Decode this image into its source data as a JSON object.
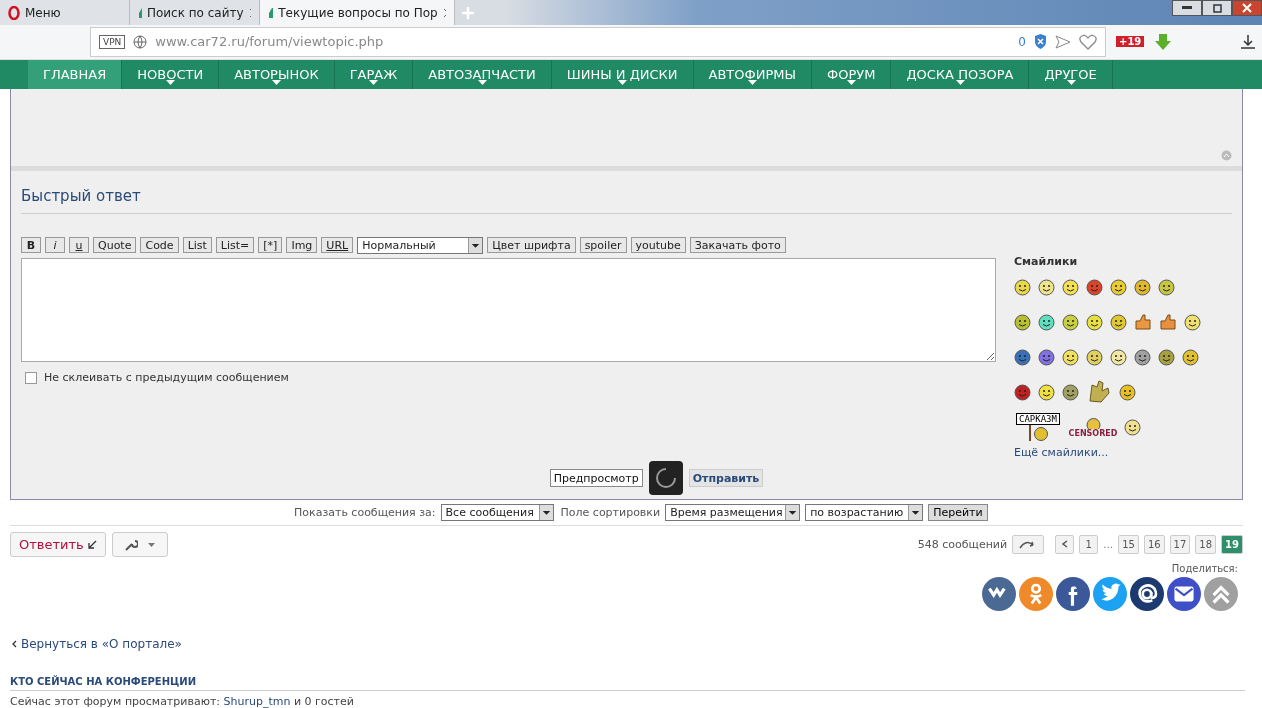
{
  "browser": {
    "tabs": [
      {
        "title": "Меню",
        "selected": false,
        "kind": "menu"
      },
      {
        "title": "Поиск по сайту",
        "selected": false,
        "kind": "page"
      },
      {
        "title": "Текущие вопросы по Пор",
        "selected": true,
        "kind": "page"
      }
    ],
    "vpn": "VPN",
    "url": "www.car72.ru/forum/viewtopic.php",
    "blocked_count": "0",
    "badge": "+19"
  },
  "nav": [
    {
      "label": "ГЛАВНАЯ",
      "selected": true,
      "has_menu": false
    },
    {
      "label": "НОВОСТИ",
      "selected": false,
      "has_menu": true
    },
    {
      "label": "АВТОРЫНОК",
      "selected": false,
      "has_menu": true
    },
    {
      "label": "ГАРАЖ",
      "selected": false,
      "has_menu": true
    },
    {
      "label": "АВТОЗАПЧАСТИ",
      "selected": false,
      "has_menu": true
    },
    {
      "label": "ШИНЫ И ДИСКИ",
      "selected": false,
      "has_menu": true
    },
    {
      "label": "АВТОФИРМЫ",
      "selected": false,
      "has_menu": true
    },
    {
      "label": "ФОРУМ",
      "selected": false,
      "has_menu": true
    },
    {
      "label": "ДОСКА ПОЗОРА",
      "selected": false,
      "has_menu": true
    },
    {
      "label": "ДРУГОЕ",
      "selected": false,
      "has_menu": true
    }
  ],
  "quick_reply": {
    "title": "Быстрый ответ",
    "toolbar": [
      {
        "label": "B",
        "kind": "bold"
      },
      {
        "label": "i",
        "kind": "italic"
      },
      {
        "label": "u",
        "kind": "underline"
      },
      {
        "label": "Quote",
        "kind": "plain"
      },
      {
        "label": "Code",
        "kind": "plain"
      },
      {
        "label": "List",
        "kind": "plain"
      },
      {
        "label": "List=",
        "kind": "plain"
      },
      {
        "label": "[*]",
        "kind": "plain"
      },
      {
        "label": "Img",
        "kind": "plain"
      },
      {
        "label": "URL",
        "kind": "link"
      },
      {
        "label": "Нормальный",
        "kind": "select"
      },
      {
        "label": "Цвет шрифта",
        "kind": "plain"
      },
      {
        "label": "spoiler",
        "kind": "plain"
      },
      {
        "label": "youtube",
        "kind": "plain"
      },
      {
        "label": "Закачать фото",
        "kind": "plain"
      }
    ],
    "no_merge": {
      "label": "Не склеивать с предыдущим сообщением",
      "checked": false
    },
    "smilies_title": "Смайлики",
    "smilies": [
      [
        {
          "kind": "face",
          "color": "#e8d84a"
        },
        {
          "kind": "face",
          "color": "#eee48a"
        },
        {
          "kind": "face",
          "color": "#f2e050"
        },
        {
          "kind": "face",
          "color": "#d9442a"
        },
        {
          "kind": "face",
          "color": "#e8cc30"
        },
        {
          "kind": "face",
          "color": "#e0b830"
        },
        {
          "kind": "face",
          "color": "#c6c640"
        }
      ],
      [
        {
          "kind": "face",
          "color": "#b8c030"
        },
        {
          "kind": "face",
          "color": "#5ee0c0"
        },
        {
          "kind": "face",
          "color": "#c8d040"
        },
        {
          "kind": "face",
          "color": "#e8e040"
        },
        {
          "kind": "face",
          "color": "#e0c830"
        },
        {
          "kind": "thumb",
          "color": "#e89840"
        },
        {
          "kind": "thumb",
          "color": "#e89040"
        },
        {
          "kind": "face",
          "color": "#f0e070"
        }
      ],
      [
        {
          "kind": "face",
          "color": "#3a70b8"
        },
        {
          "kind": "face",
          "color": "#8070e0"
        },
        {
          "kind": "face",
          "color": "#f0e060"
        },
        {
          "kind": "face",
          "color": "#e0d060"
        },
        {
          "kind": "face",
          "color": "#f0e8a0"
        },
        {
          "kind": "face",
          "color": "#a0a0a0"
        },
        {
          "kind": "face",
          "color": "#a8a040"
        },
        {
          "kind": "face",
          "color": "#e0c030"
        }
      ],
      [
        {
          "kind": "face",
          "color": "#c02020"
        },
        {
          "kind": "face",
          "color": "#f0e040"
        },
        {
          "kind": "face",
          "color": "#a0a060"
        },
        {
          "kind": "hands",
          "color": "#c0b050"
        },
        {
          "kind": "face",
          "color": "#e8c020"
        }
      ],
      [
        {
          "kind": "sign",
          "color": "#e0c030",
          "label": "САРКАЗМ"
        },
        {
          "kind": "stamp",
          "color": "#e8c040",
          "label": "CENSORED"
        },
        {
          "kind": "face",
          "color": "#f0e090"
        }
      ]
    ],
    "more_smilies": "Ещё смайлики...",
    "buttons": [
      {
        "label": "Предпросмотр",
        "primary": false
      },
      {
        "label": "Отправить",
        "primary": true
      }
    ]
  },
  "sort_bar": {
    "show_label": "Показать сообщения за:",
    "show_value": "Все сообщения",
    "sort_label": "Поле сортировки",
    "sort_value": "Время размещения",
    "order_value": "по возрастанию",
    "go": "Перейти"
  },
  "actions": {
    "reply": "Ответить",
    "count": "548 сообщений",
    "pages": [
      {
        "label": "1",
        "selected": false
      },
      {
        "label": "…",
        "kind": "gap"
      },
      {
        "label": "15",
        "selected": false
      },
      {
        "label": "16",
        "selected": false
      },
      {
        "label": "17",
        "selected": false
      },
      {
        "label": "18",
        "selected": false
      },
      {
        "label": "19",
        "selected": true
      }
    ],
    "share_label": "Поделиться:",
    "share": [
      {
        "kind": "vk",
        "color": "#4a6a94"
      },
      {
        "kind": "ok",
        "color": "#ee8a2a"
      },
      {
        "kind": "facebook",
        "color": "#3b5998"
      },
      {
        "kind": "twitter",
        "color": "#1da1f2"
      },
      {
        "kind": "at",
        "color": "#1d3a70"
      },
      {
        "kind": "mail",
        "color": "#3f4fc8"
      },
      {
        "kind": "up",
        "color": "#a0a0a0"
      }
    ]
  },
  "back_link": "Вернуться в «О портале»",
  "online": {
    "title": "КТО СЕЙЧАС НА КОНФЕРЕНЦИИ",
    "text": "Сейчас этот форум просматривают:",
    "user": "Shurup_tmn",
    "rest": "и 0 гостей"
  }
}
